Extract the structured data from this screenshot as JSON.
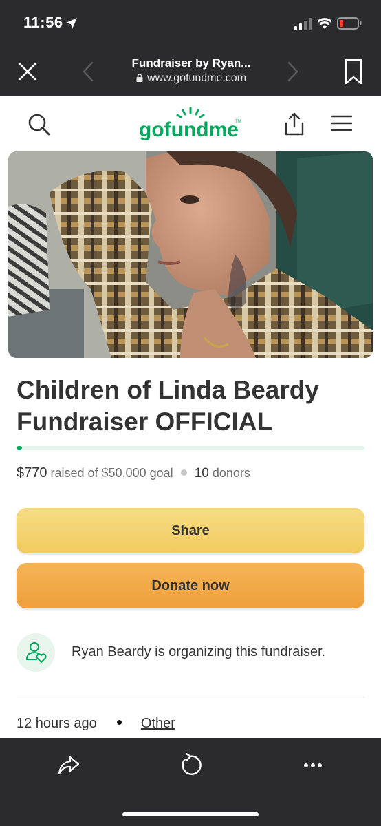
{
  "status_bar": {
    "time": "11:56"
  },
  "browser": {
    "title": "Fundraiser by Ryan...",
    "url": "www.gofundme.com"
  },
  "site": {
    "logo_text": "gofundme",
    "logo_tm": "TM"
  },
  "campaign": {
    "title": "Children of Linda Beardy Fundraiser OFFICIAL",
    "raised": "$770",
    "raised_suffix": "raised of $50,000 goal",
    "donor_count": "10",
    "donor_label": "donors",
    "progress_fraction": 0.0154
  },
  "actions": {
    "share_label": "Share",
    "donate_label": "Donate now"
  },
  "organizer": {
    "text": "Ryan Beardy is organizing this fundraiser."
  },
  "meta": {
    "time_ago": "12 hours ago",
    "category": "Other"
  },
  "colors": {
    "brand_green": "#02a95c",
    "share_button": "#f3d06b",
    "donate_button": "#f2a94a",
    "chrome_dark": "#2b2b2d"
  },
  "icons": {
    "status": [
      "location-arrow-icon",
      "cellular-signal-icon",
      "wifi-icon",
      "battery-low-icon"
    ],
    "browser": [
      "close-icon",
      "chevron-left-icon",
      "chevron-right-icon",
      "bookmark-icon",
      "lock-icon"
    ],
    "header": [
      "search-icon",
      "share-upload-icon",
      "hamburger-menu-icon"
    ],
    "toolbar": [
      "share-arrow-icon",
      "reload-icon",
      "more-dots-icon"
    ]
  }
}
